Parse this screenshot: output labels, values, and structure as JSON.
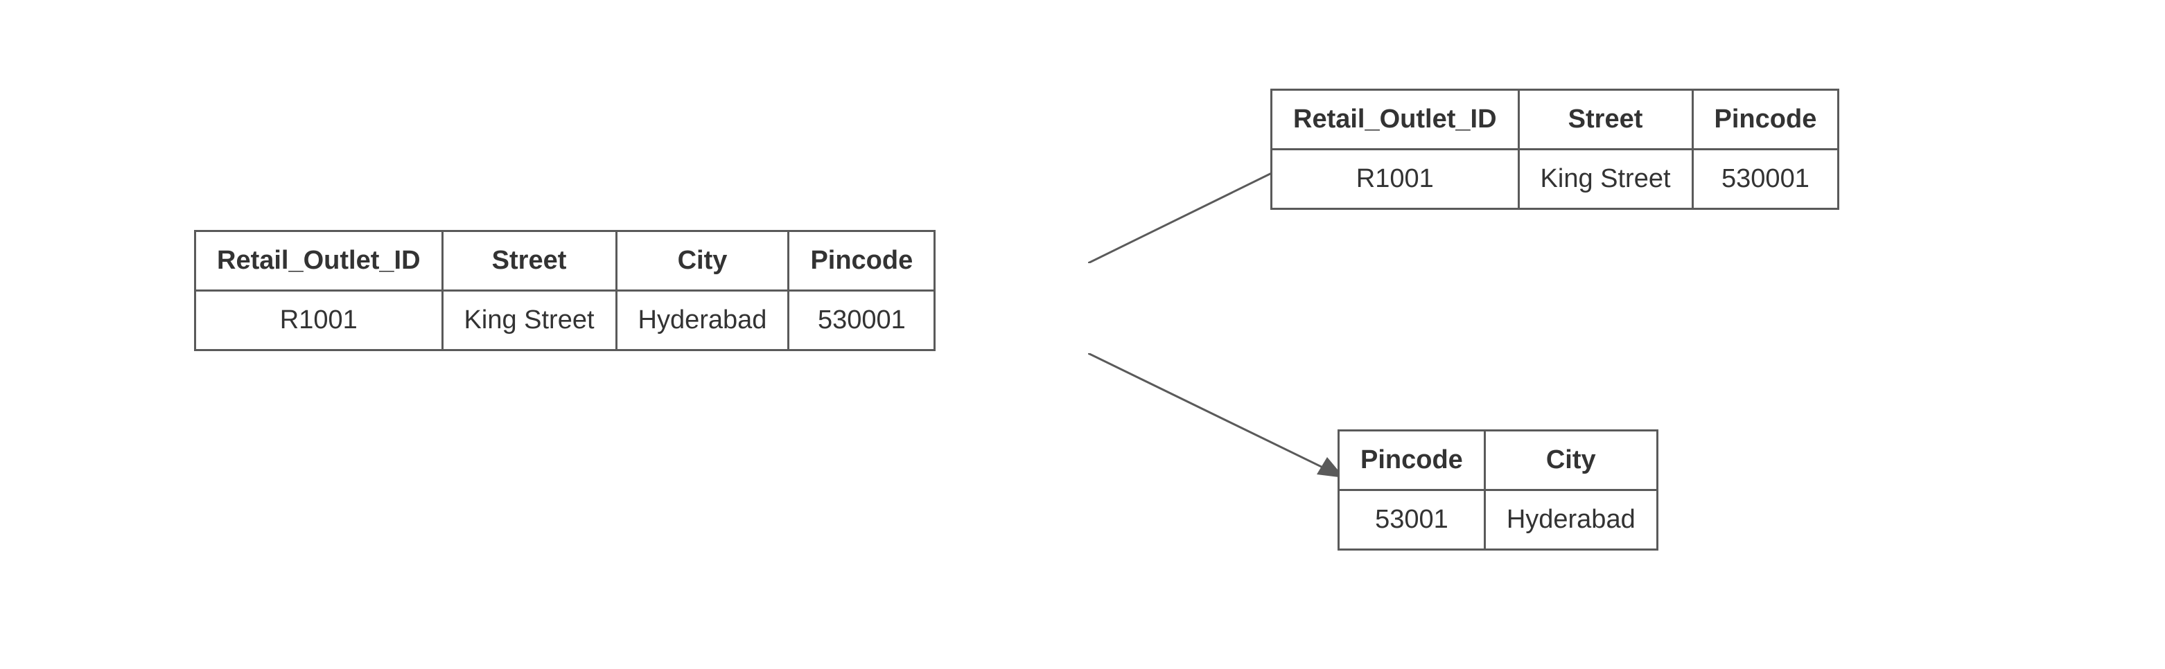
{
  "source_table": {
    "headers": {
      "col1": "Retail_Outlet_ID",
      "col2": "Street",
      "col3": "City",
      "col4": "Pincode"
    },
    "row": {
      "col1": "R1001",
      "col2": "King Street",
      "col3": "Hyderabad",
      "col4": "530001"
    }
  },
  "result_table_1": {
    "headers": {
      "col1": "Retail_Outlet_ID",
      "col2": "Street",
      "col3": "Pincode"
    },
    "row": {
      "col1": "R1001",
      "col2": "King Street",
      "col3": "530001"
    }
  },
  "result_table_2": {
    "headers": {
      "col1": "Pincode",
      "col2": "City"
    },
    "row": {
      "col1": "53001",
      "col2": "Hyderabad"
    }
  }
}
